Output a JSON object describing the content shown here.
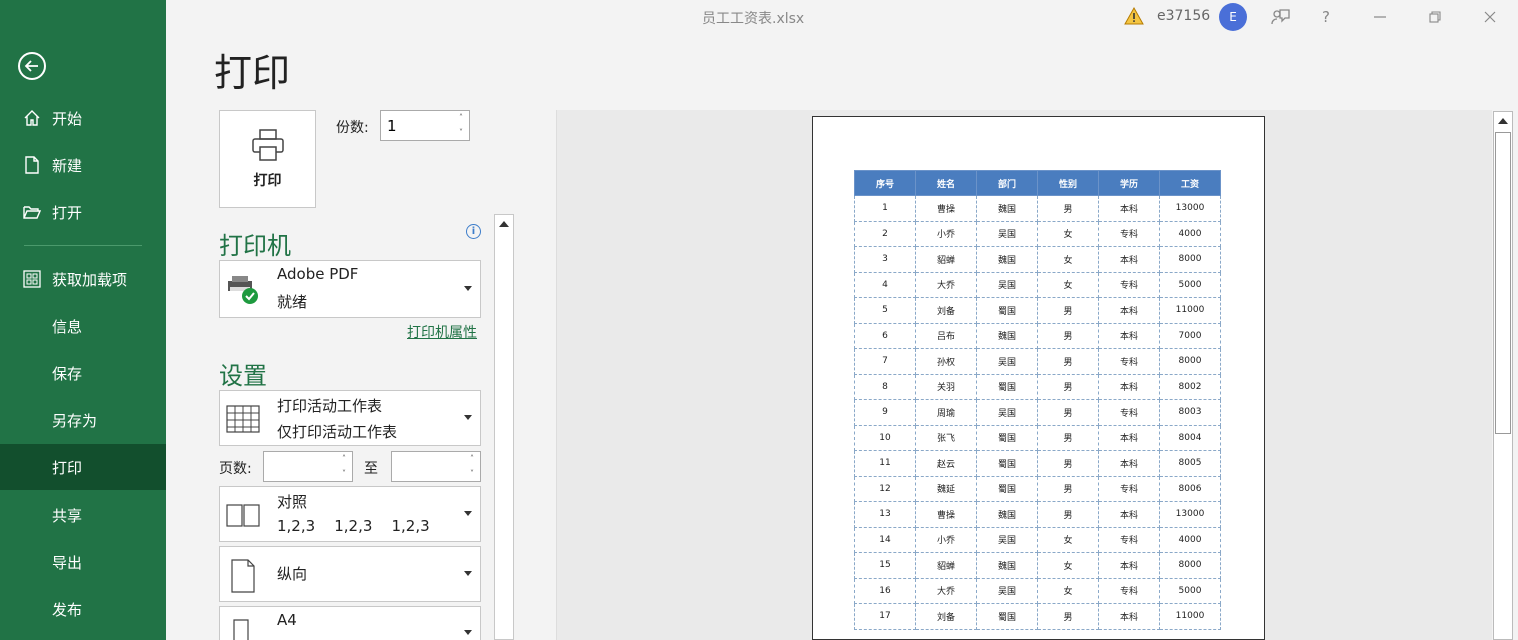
{
  "window": {
    "title": "员工工资表.xlsx",
    "user": "e37156",
    "avatar_initial": "E",
    "help_label": "?"
  },
  "sidebar": {
    "items": [
      {
        "label": "开始",
        "icon": "home-icon"
      },
      {
        "label": "新建",
        "icon": "new-document-icon"
      },
      {
        "label": "打开",
        "icon": "folder-open-icon"
      },
      {
        "label": "获取加载项",
        "icon": "addins-grid-icon"
      },
      {
        "label": "信息"
      },
      {
        "label": "保存"
      },
      {
        "label": "另存为"
      },
      {
        "label": "打印"
      },
      {
        "label": "共享"
      },
      {
        "label": "导出"
      },
      {
        "label": "发布"
      }
    ],
    "active": "打印"
  },
  "page_title": "打印",
  "print_panel": {
    "print_button_label": "打印",
    "copies_label": "份数:",
    "copies_value": "1",
    "printer_title": "打印机",
    "printer_name": "Adobe PDF",
    "printer_status": "就绪",
    "printer_properties_link": "打印机属性",
    "settings_title": "设置",
    "scope_line1": "打印活动工作表",
    "scope_line2": "仅打印活动工作表",
    "pages_label": "页数:",
    "pages_to_label": "至",
    "collate_line1": "对照",
    "collate_line2": "1,2,3    1,2,3    1,2,3",
    "orientation": "纵向",
    "paper_size": "A4"
  },
  "preview": {
    "headers": [
      "序号",
      "姓名",
      "部门",
      "性别",
      "学历",
      "工资"
    ],
    "rows": [
      [
        "1",
        "曹操",
        "魏国",
        "男",
        "本科",
        "13000"
      ],
      [
        "2",
        "小乔",
        "吴国",
        "女",
        "专科",
        "4000"
      ],
      [
        "3",
        "貂蝉",
        "魏国",
        "女",
        "本科",
        "8000"
      ],
      [
        "4",
        "大乔",
        "吴国",
        "女",
        "专科",
        "5000"
      ],
      [
        "5",
        "刘备",
        "蜀国",
        "男",
        "本科",
        "11000"
      ],
      [
        "6",
        "吕布",
        "魏国",
        "男",
        "本科",
        "7000"
      ],
      [
        "7",
        "孙权",
        "吴国",
        "男",
        "专科",
        "8000"
      ],
      [
        "8",
        "关羽",
        "蜀国",
        "男",
        "本科",
        "8002"
      ],
      [
        "9",
        "周瑜",
        "吴国",
        "男",
        "专科",
        "8003"
      ],
      [
        "10",
        "张飞",
        "蜀国",
        "男",
        "本科",
        "8004"
      ],
      [
        "11",
        "赵云",
        "蜀国",
        "男",
        "本科",
        "8005"
      ],
      [
        "12",
        "魏延",
        "蜀国",
        "男",
        "专科",
        "8006"
      ],
      [
        "13",
        "曹操",
        "魏国",
        "男",
        "本科",
        "13000"
      ],
      [
        "14",
        "小乔",
        "吴国",
        "女",
        "专科",
        "4000"
      ],
      [
        "15",
        "貂蝉",
        "魏国",
        "女",
        "本科",
        "8000"
      ],
      [
        "16",
        "大乔",
        "吴国",
        "女",
        "专科",
        "5000"
      ],
      [
        "17",
        "刘备",
        "蜀国",
        "男",
        "本科",
        "11000"
      ]
    ]
  },
  "colors": {
    "sidebar": "#217346",
    "sidebar_active": "#124f2d",
    "accent": "#217346",
    "table_header": "#4a7dbf"
  }
}
